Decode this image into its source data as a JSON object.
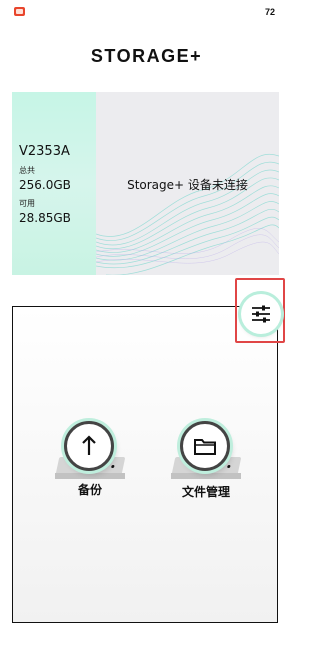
{
  "status_bar": {
    "battery": "72",
    "app_icon": "app-notification-icon"
  },
  "header": {
    "logo_text": "STORAGE+"
  },
  "device": {
    "model": "V2353A",
    "total_label": "总共",
    "total_value": "256.0GB",
    "available_label": "可用",
    "available_value": "28.85GB",
    "connection_status": "Storage+ 设备未连接"
  },
  "settings_button": {
    "icon": "sliders-icon"
  },
  "actions": [
    {
      "label": "备份",
      "icon": "upload-arrow-icon"
    },
    {
      "label": "文件管理",
      "icon": "folder-icon"
    }
  ],
  "colors": {
    "accent_mint": "#c6f5e6",
    "wave_teal": "#7fd8d0",
    "highlight_red": "#e04646"
  }
}
